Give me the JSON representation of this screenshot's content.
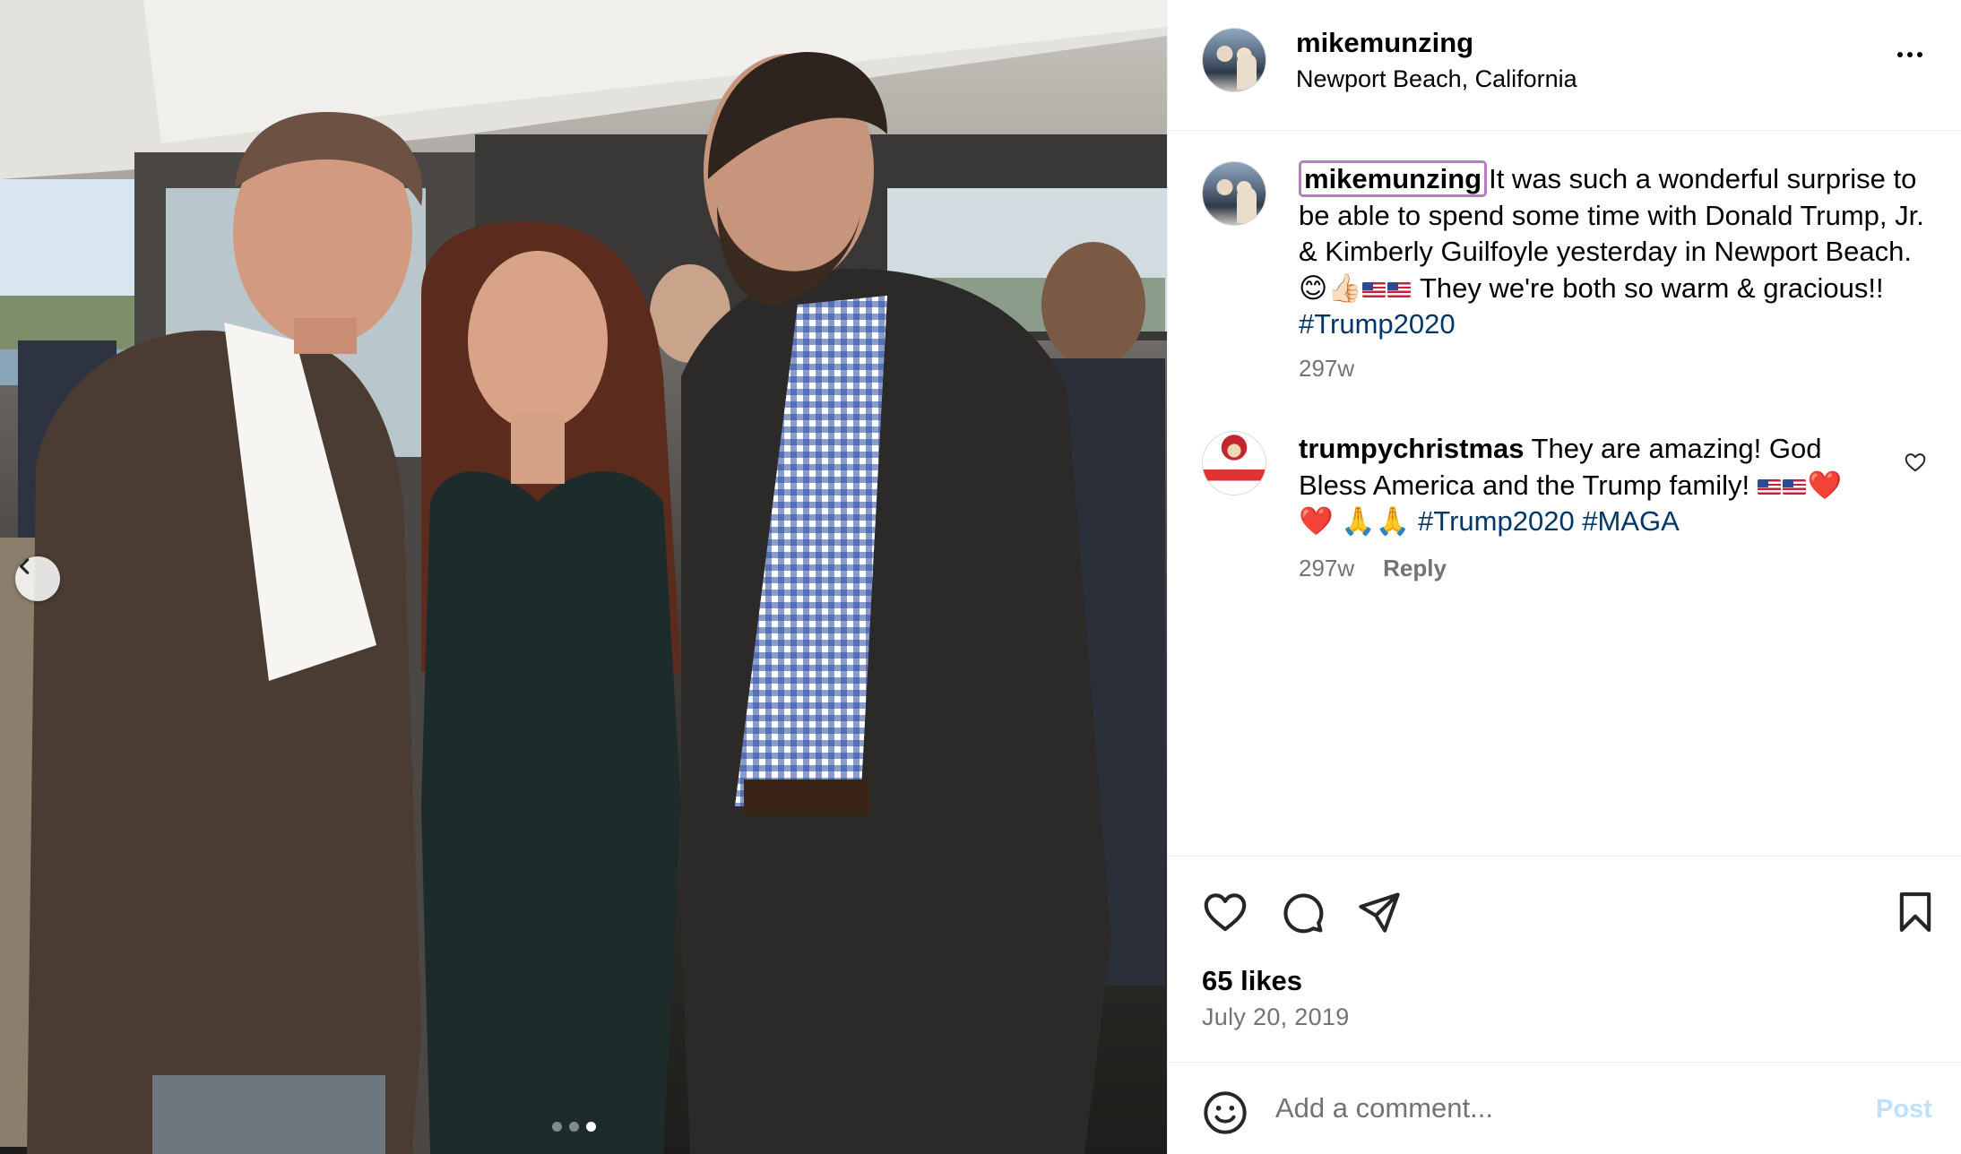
{
  "post": {
    "slide_count": 3,
    "active_slide": 3
  },
  "header": {
    "username": "mikemunzing",
    "location": "Newport Beach, California"
  },
  "caption": {
    "username": "mikemunzing",
    "text_1": "It was such a wonderful surprise to be able to spend some time with Donald Trump, Jr. & Kimberly Guilfoyle yesterday in Newport Beach. ",
    "emoji_1": "😊👍🏻",
    "text_2": " They we're both so warm & gracious!! ",
    "hashtag": "#Trump2020",
    "age": "297w"
  },
  "comments": [
    {
      "username": "trumpychristmas",
      "text_1": "They are amazing! God Bless America and the Trump family! ",
      "emoji_hearts": "❤️❤️",
      "emoji_hands": "🙏🙏",
      "hashtag_1": "#Trump2020",
      "hashtag_2": "#MAGA",
      "age": "297w",
      "reply_label": "Reply"
    }
  ],
  "actions": {
    "likes": "65 likes",
    "date": "July 20, 2019"
  },
  "comment_box": {
    "placeholder": "Add a comment...",
    "post_label": "Post"
  },
  "colors": {
    "hashtag": "#00376b",
    "muted": "#737373",
    "post_disabled": "#c0dffd",
    "divider": "#efefef"
  }
}
